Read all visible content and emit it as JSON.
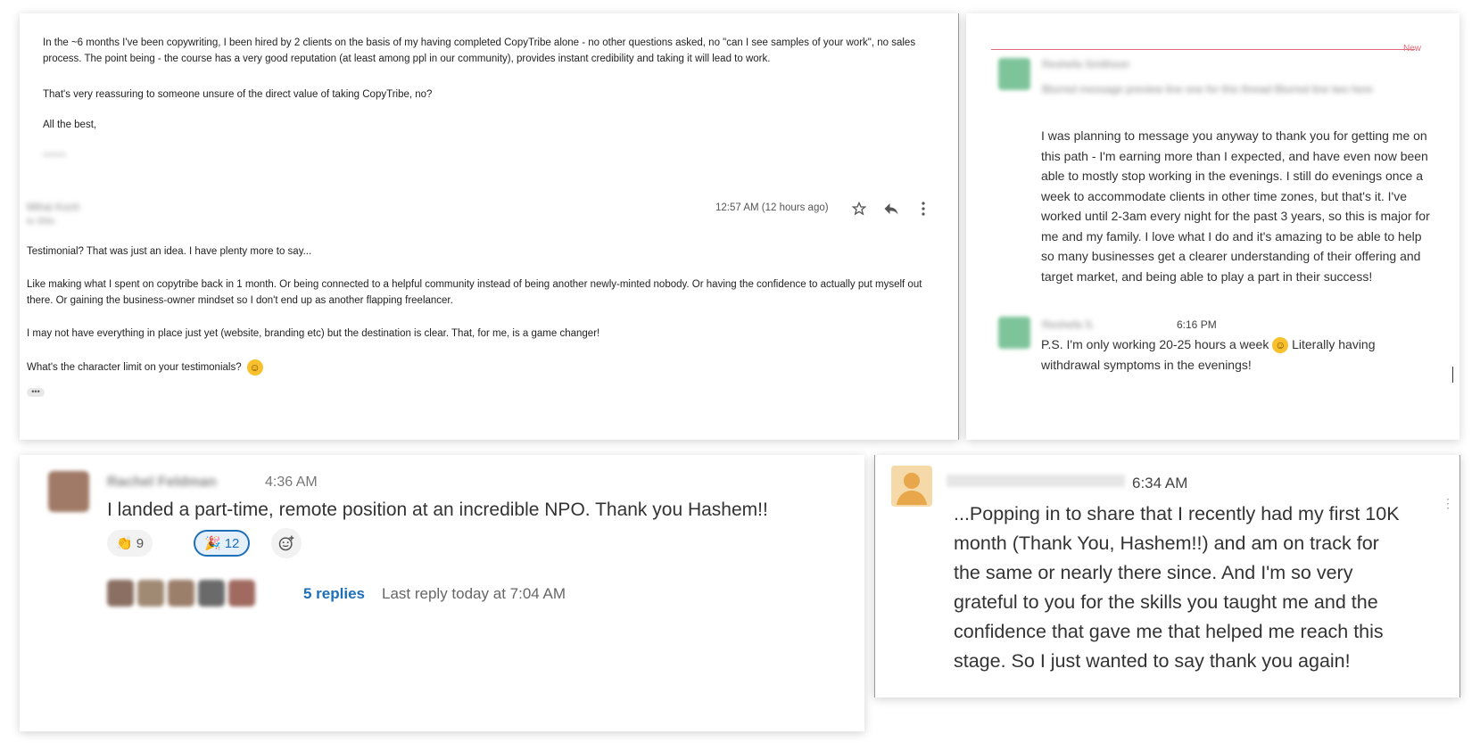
{
  "email": {
    "paragraphs": [
      "In the ~6 months I've been copywriting, I been hired by 2 clients on the basis of my having completed CopyTribe alone - no other questions asked, no \"can I see samples of your work\", no sales process. The point being - the course has a very good reputation (at least among ppl in our community), provides instant credibility and taking it will lead to work.",
      "That's very reassuring to someone unsure of the direct value of taking CopyTribe, no?",
      "All the best,"
    ],
    "signature_blurred": "~~~~",
    "sender_name_blurred": "Mihai Koch",
    "sender_to_blurred": "to Shlo",
    "time": "12:57 AM (12 hours ago)",
    "body": [
      "Testimonial? That was just an idea. I have plenty more to say...",
      "Like making what I spent on copytribe back in 1 month. Or being connected to a helpful community instead of being another newly-minted nobody. Or having the confidence to actually put myself out there. Or gaining the business-owner mindset so I don't end up as another flapping freelancer.",
      "I may not have everything in place just yet (website, branding etc) but the destination is clear. That, for me, is a game changer!",
      "What's the character limit on your testimonials?"
    ],
    "ellipsis": "•••"
  },
  "chat1": {
    "new_label": "New",
    "first_name_blurred": "Reshefa Smithson",
    "blurred_text": "Blurred message preview line one for this thread Blurred line two here",
    "message": "I was planning to message you anyway to thank you for getting me on this path - I'm earning more than I expected, and have even now been able to mostly stop working in the evenings. I still do evenings once a week to accommodate clients in other time zones, but that's it. I've worked until 2-3am every night for the past 3 years, so this is major for me and my family. I love what I do and it's amazing to be able to help so many businesses get a clearer understanding of their offering and target market, and being able to play a part in their success!",
    "second_name_blurred": "Reshefa S.",
    "second_time": "6:16 PM",
    "ps_before": "P.S. I'm only working 20-25 hours a week",
    "ps_after": "Literally having withdrawal symptoms in the evenings!"
  },
  "chat2": {
    "name_blurred": "Rachel Feldman",
    "time": "4:36 AM",
    "message": "I  landed a part-time, remote position at an incredible NPO. Thank you Hashem!!",
    "reaction1_count": "9",
    "reaction2_count": "12",
    "replies": "5 replies",
    "last_reply": "Last reply today at 7:04 AM",
    "colors": {
      "link": "#1d6fb8"
    }
  },
  "chat3": {
    "time": "6:34 AM",
    "message": "...Popping in to share that I recently had my first 10K month (Thank You, Hashem!!) and am on track for the same or nearly there since. And I'm so very grateful to you for the skills you taught me and the confidence that gave me that helped me reach this stage. So I just wanted to say thank you again!"
  }
}
